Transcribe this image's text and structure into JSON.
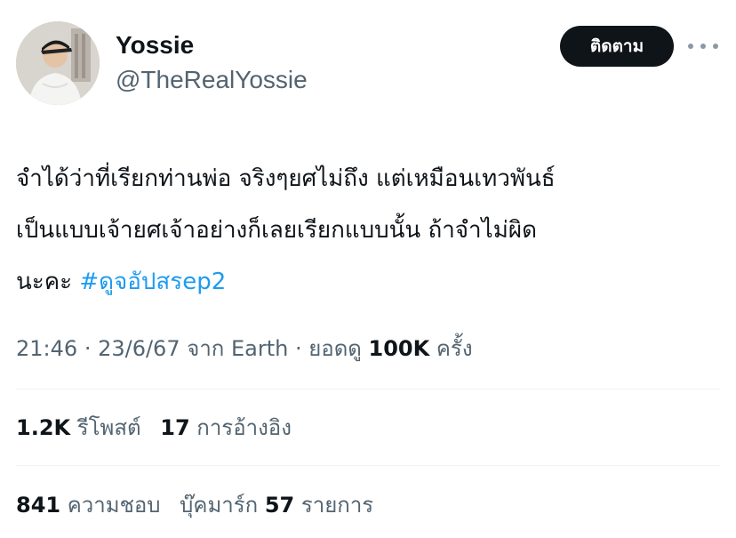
{
  "user": {
    "display_name": "Yossie",
    "handle": "@TheRealYossie",
    "avatar_icon": "profile-photo"
  },
  "actions": {
    "follow_label": "ติดตาม",
    "more_icon": "more-horizontal-icon"
  },
  "tweet": {
    "text_line1": "จำได้ว่าที่เรียกท่านพ่อ จริงๆยศไม่ถึง แต่เหมือนเทวพันธ์",
    "text_line2": "เป็นแบบเจ้ายศเจ้าอย่างก็เลยเรียกแบบนั้น ถ้าจำไม่ผิด",
    "text_line3_prefix": "นะคะ ",
    "hashtag": "#ดูจอัปสรep2"
  },
  "meta": {
    "time": "21:46",
    "date": "23/6/67",
    "source_prefix": "จาก",
    "source": "Earth",
    "views_prefix": "ยอดดู",
    "views_count": "100K",
    "views_suffix": "ครั้ง"
  },
  "stats_row1": {
    "retweets_count": "1.2K",
    "retweets_label": "รีโพสต์",
    "quotes_count": "17",
    "quotes_label": "การอ้างอิง"
  },
  "stats_row2": {
    "likes_count": "841",
    "likes_label": "ความชอบ",
    "bookmarks_label": "บุ๊คมาร์ก",
    "bookmarks_count": "57",
    "bookmarks_suffix": "รายการ"
  },
  "colors": {
    "text": "#0f1419",
    "secondary": "#536471",
    "link": "#1d9bf0",
    "button_bg": "#0f1419",
    "divider": "#eff3f4"
  }
}
